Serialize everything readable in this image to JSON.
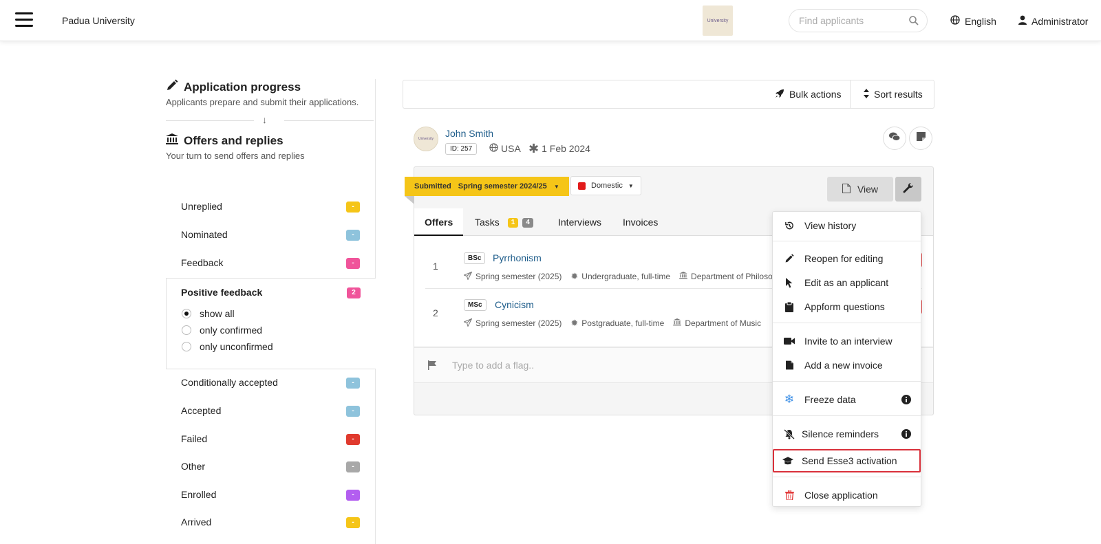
{
  "header": {
    "brand": "Padua University",
    "logo_text": "University",
    "search_placeholder": "Find applicants",
    "language": "English",
    "user": "Administrator"
  },
  "sidebar": {
    "progress_title": "Application progress",
    "progress_subtitle": "Applicants prepare and submit their applications.",
    "offers_title": "Offers and replies",
    "offers_subtitle": "Your turn to send offers and replies",
    "statuses": [
      {
        "label": "Unreplied",
        "badge": "-",
        "color": "#f5c518"
      },
      {
        "label": "Nominated",
        "badge": "-",
        "color": "#8ec3dc"
      },
      {
        "label": "Feedback",
        "badge": "-",
        "color": "#f0549a"
      },
      {
        "label": "Positive feedback",
        "badge": "2",
        "color": "#f0549a"
      },
      {
        "label": "Conditionally accepted",
        "badge": "-",
        "color": "#8ec3dc"
      },
      {
        "label": "Accepted",
        "badge": "-",
        "color": "#8ec3dc"
      },
      {
        "label": "Failed",
        "badge": "-",
        "color": "#e03a2e"
      },
      {
        "label": "Other",
        "badge": "-",
        "color": "#a8a8a8"
      },
      {
        "label": "Enrolled",
        "badge": "-",
        "color": "#b35ef0"
      },
      {
        "label": "Arrived",
        "badge": "-",
        "color": "#f5c518"
      }
    ],
    "filters": [
      {
        "label": "show all",
        "selected": true
      },
      {
        "label": "only confirmed",
        "selected": false
      },
      {
        "label": "only unconfirmed",
        "selected": false
      }
    ]
  },
  "toolbar": {
    "bulk_actions": "Bulk actions",
    "sort_results": "Sort results"
  },
  "applicant": {
    "name": "John Smith",
    "id": "ID: 257",
    "country": "USA",
    "date": "1 Feb 2024",
    "status": "Submitted",
    "semester": "Spring semester 2024/25",
    "residency": "Domestic",
    "view_label": "View"
  },
  "tabs": [
    {
      "label": "Offers"
    },
    {
      "label": "Tasks",
      "badge1": "1",
      "badge2": "4"
    },
    {
      "label": "Interviews"
    },
    {
      "label": "Invoices"
    }
  ],
  "offers": [
    {
      "num": "1",
      "degree": "BSc",
      "name": "Pyrrhonism",
      "semester": "Spring semester (2025)",
      "mode": "Undergraduate, full-time",
      "dept": "Department of Philosop"
    },
    {
      "num": "2",
      "degree": "MSc",
      "name": "Cynicism",
      "semester": "Spring semester (2025)",
      "mode": "Postgraduate, full-time",
      "dept": "Department of Music"
    }
  ],
  "flag_placeholder": "Type to add a flag..",
  "menu": {
    "view_history": "View history",
    "reopen": "Reopen for editing",
    "edit_applicant": "Edit as an applicant",
    "appform": "Appform questions",
    "invite": "Invite to an interview",
    "invoice": "Add a new invoice",
    "freeze": "Freeze data",
    "silence": "Silence reminders",
    "esse3": "Send Esse3 activation",
    "close": "Close application"
  }
}
